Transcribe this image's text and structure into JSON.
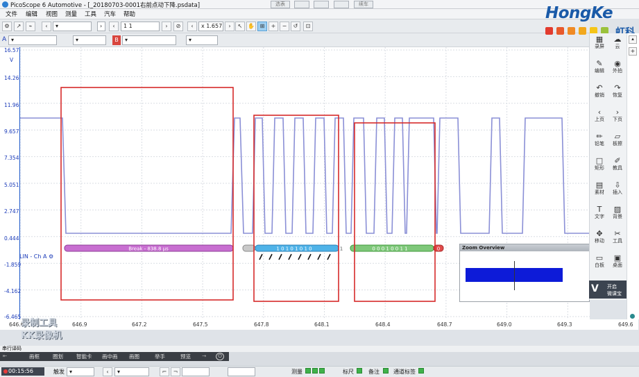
{
  "window": {
    "title": "PicoScope 6 Automotive - [_20180703-0001右前点动下降.psdata]",
    "top_buttons": [
      "选表",
      "",
      "",
      "",
      "续车"
    ]
  },
  "menu": [
    "文件",
    "编辑",
    "视图",
    "测量",
    "工具",
    "汽车",
    "帮助"
  ],
  "toolbar": {
    "buffer_value": "1 1",
    "zoom_value": "x 1.657"
  },
  "channels": {
    "a_label": "A",
    "b_label": "B"
  },
  "logo": {
    "brand": "HongKe",
    "cn": "虹科",
    "squares": [
      "#e23b2e",
      "#e8592b",
      "#f08a24",
      "#f2a81d",
      "#f5c518",
      "#9bc23c"
    ]
  },
  "y_axis": {
    "unit": "V",
    "ticks": [
      "16.57",
      "14.26",
      "11.96",
      "9.657",
      "7.354",
      "5.051",
      "2.747",
      "0.444",
      "-1.859",
      "-4.162",
      "-6.465"
    ]
  },
  "x_axis": {
    "ticks": [
      "646.6",
      "646.9",
      "647.2",
      "647.5",
      "647.8",
      "648.1",
      "648.4",
      "648.7",
      "649.0",
      "649.3",
      "649.6"
    ]
  },
  "decode": {
    "lin_label": "LIN - Ch A",
    "break_text": "Break - 838.8 μs",
    "byte1": "1 0 1 0 1 0 1 0",
    "byte1_end": "1",
    "byte2": "0 0 0 1 0 0 1 1",
    "byte2_end": "0"
  },
  "zoom_overview": {
    "title": "Zoom Overview"
  },
  "right_panel": [
    {
      "label": "录屏",
      "icon": "record-icon"
    },
    {
      "label": "云",
      "icon": "cloud-icon"
    },
    {
      "label": "编辑",
      "icon": "edit-icon"
    },
    {
      "label": "外拍",
      "icon": "camera-icon"
    },
    {
      "label": "撤销",
      "icon": "undo-icon"
    },
    {
      "label": "恢复",
      "icon": "redo-icon"
    },
    {
      "label": "上页",
      "icon": "prev-page-icon"
    },
    {
      "label": "下页",
      "icon": "next-page-icon"
    },
    {
      "label": "铅笔",
      "icon": "pencil-icon"
    },
    {
      "label": "板擦",
      "icon": "eraser-icon"
    },
    {
      "label": "矩形",
      "icon": "rectangle-icon"
    },
    {
      "label": "教具",
      "icon": "teaching-tool-icon"
    },
    {
      "label": "素材",
      "icon": "material-icon"
    },
    {
      "label": "插入",
      "icon": "insert-icon"
    },
    {
      "label": "文字",
      "icon": "text-icon"
    },
    {
      "label": "背景",
      "icon": "background-icon"
    },
    {
      "label": "移动",
      "icon": "move-icon"
    },
    {
      "label": "工具",
      "icon": "tools-icon"
    },
    {
      "label": "白板",
      "icon": "whiteboard-icon"
    },
    {
      "label": "桌面",
      "icon": "desktop-icon"
    }
  ],
  "badge": {
    "line1": "开启",
    "line2": "微课宝"
  },
  "serial": {
    "title": "串行译码"
  },
  "overlay_menu": [
    "画框",
    "圈划",
    "智能卡",
    "画中画",
    "画图",
    "举手",
    "预览"
  ],
  "watermark": {
    "line1": "录制工具",
    "line2": "KK录像机"
  },
  "bottom": {
    "time": "00:15:56",
    "trigger": "触发",
    "measure": "测量",
    "ruler": "标尺",
    "notes": "备注",
    "channel_tags": "通道标签"
  }
}
